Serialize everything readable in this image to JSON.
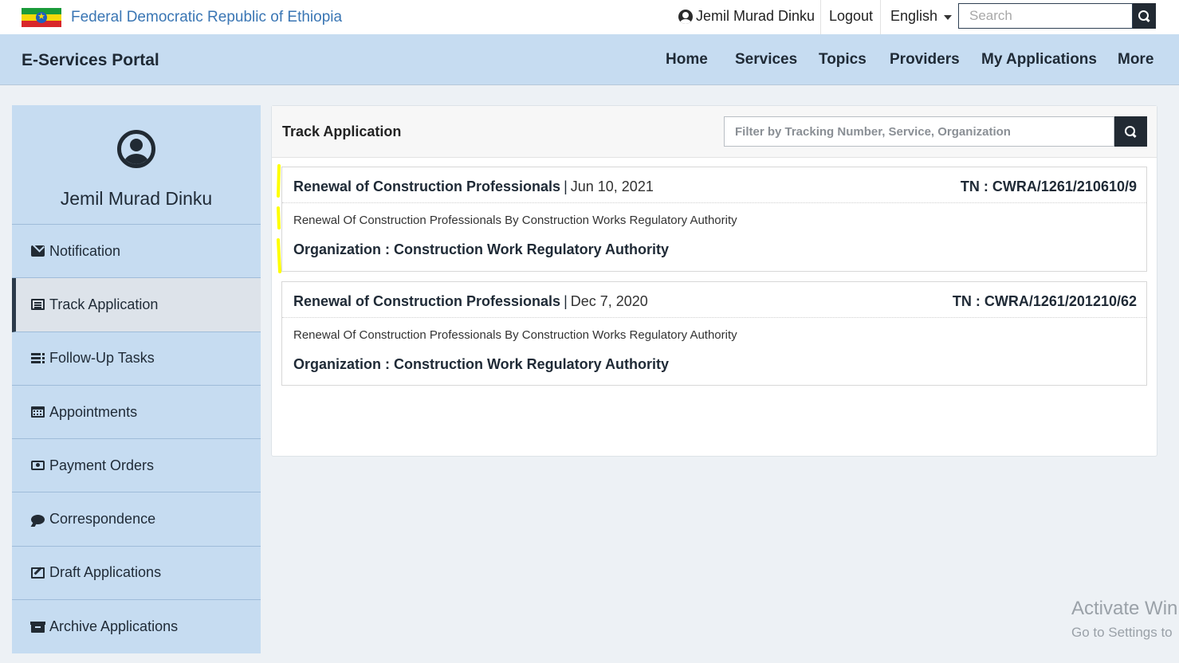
{
  "topbar": {
    "gov_title": "Federal Democratic Republic of Ethiopia",
    "user_name": "Jemil Murad Dinku",
    "logout_label": "Logout",
    "language": "English",
    "search_placeholder": "Search",
    "flag_colors": [
      "#1a9b3a",
      "#f4d90a",
      "#d8262a"
    ]
  },
  "navbar": {
    "portal_title": "E-Services Portal",
    "items": [
      "Home",
      "Services",
      "Topics",
      "Providers",
      "My Applications",
      "More"
    ]
  },
  "sidebar": {
    "profile_name": "Jemil Murad Dinku",
    "active_item": "Track Application",
    "items": [
      {
        "label": "Notification",
        "icon": "envelope-icon"
      },
      {
        "label": "Track Application",
        "icon": "list-alt-icon"
      },
      {
        "label": "Follow-Up Tasks",
        "icon": "tasks-icon"
      },
      {
        "label": "Appointments",
        "icon": "calendar-icon"
      },
      {
        "label": "Payment Orders",
        "icon": "money-icon"
      },
      {
        "label": "Correspondence",
        "icon": "comment-icon"
      },
      {
        "label": "Draft Applications",
        "icon": "edit-icon"
      },
      {
        "label": "Archive Applications",
        "icon": "archive-icon"
      }
    ]
  },
  "main": {
    "title": "Track Application",
    "filter_placeholder": "Filter by Tracking Number, Service, Organization",
    "applications": [
      {
        "service": "Renewal of Construction Professionals",
        "separator": "|",
        "date": "Jun 10, 2021",
        "tracking_number": "TN : CWRA/1261/210610/9",
        "description": "Renewal Of Construction Professionals By Construction Works Regulatory Authority",
        "organization": "Organization : Construction Work Regulatory Authority"
      },
      {
        "service": "Renewal of Construction Professionals",
        "separator": "|",
        "date": "Dec 7, 2020",
        "tracking_number": "TN : CWRA/1261/201210/62",
        "description": "Renewal Of Construction Professionals By Construction Works Regulatory Authority",
        "organization": "Organization : Construction Work Regulatory Authority"
      }
    ]
  },
  "watermark": {
    "line1": "Activate Win",
    "line2": "Go to Settings to"
  },
  "colors": {
    "navbar_bg": "#c6dcf1",
    "dark_button": "#222a33",
    "highlight": "#ffff00",
    "link_blue": "#3a76b4"
  }
}
